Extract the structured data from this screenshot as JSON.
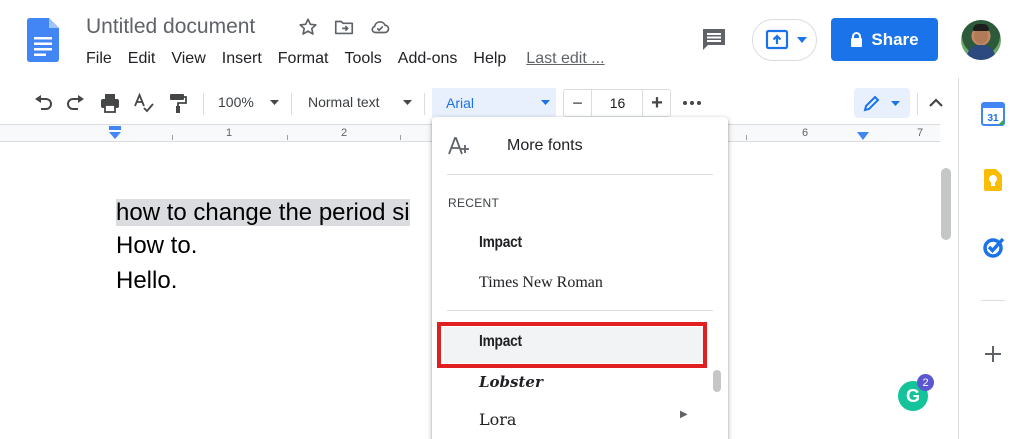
{
  "header": {
    "title": "Untitled document",
    "menu": [
      "File",
      "Edit",
      "View",
      "Insert",
      "Format",
      "Tools",
      "Add-ons",
      "Help"
    ],
    "last_edit": "Last edit ...",
    "share_label": "Share",
    "icons": [
      "docs-logo-icon",
      "star-icon",
      "move-to-folder-icon",
      "cloud-saved-icon",
      "comments-icon",
      "present-icon",
      "lock-icon",
      "avatar"
    ]
  },
  "toolbar": {
    "zoom": "100%",
    "style": "Normal text",
    "font": "Arial",
    "font_size": "16",
    "minus": "−",
    "plus": "+",
    "icons": [
      "undo-icon",
      "redo-icon",
      "print-icon",
      "spellcheck-icon",
      "paint-format-icon",
      "more-icon",
      "pencil-icon",
      "collapse-icon"
    ]
  },
  "ruler": {
    "marks": [
      "1",
      "2",
      "6",
      "7"
    ]
  },
  "document": {
    "lines": [
      "how to change the period si",
      "How to.",
      "Hello."
    ]
  },
  "font_menu": {
    "more_fonts": "More fonts",
    "recent_label": "RECENT",
    "recent": [
      "Impact",
      "Times New Roman"
    ],
    "fonts": [
      "Impact",
      "Lobster",
      "Lora"
    ],
    "highlighted_font": "Impact"
  },
  "side_panel": {
    "icons": [
      "calendar-icon",
      "keep-icon",
      "tasks-icon",
      "add-icon"
    ],
    "calendar_day": "31"
  },
  "grammarly": {
    "letter": "G",
    "count": "2"
  },
  "colors": {
    "accent": "#1a73e8",
    "highlight_border": "#e02020",
    "grammarly": "#15c39a"
  }
}
